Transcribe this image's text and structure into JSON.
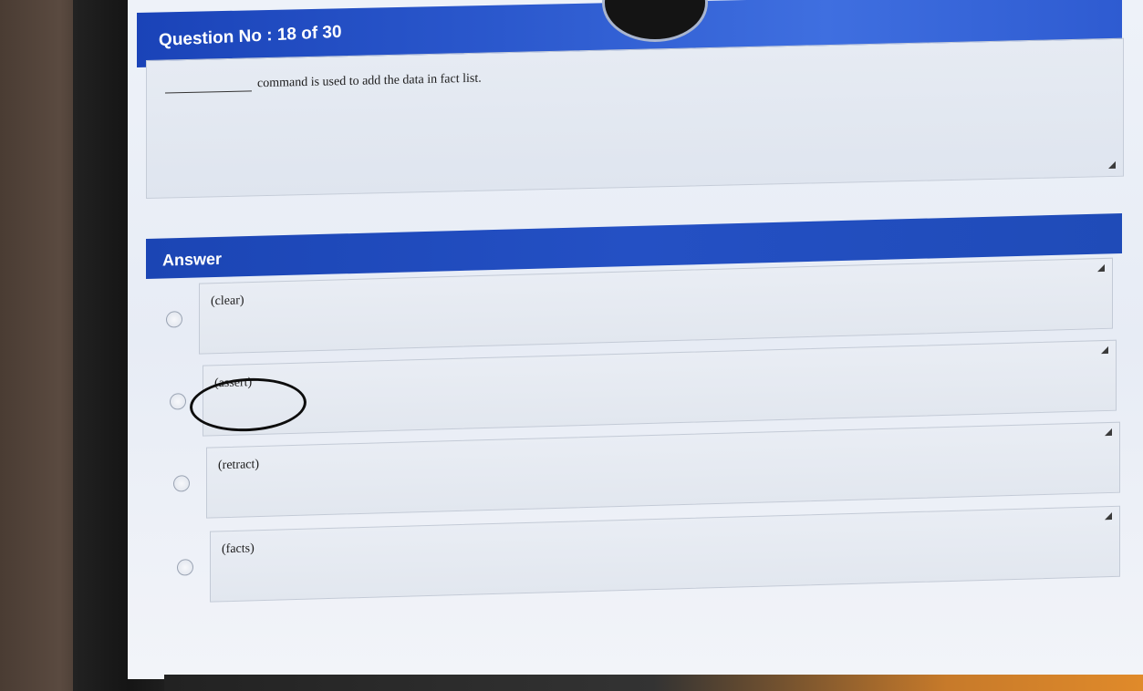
{
  "question": {
    "header": "Question No : 18 of 30",
    "text": "command is used to add the data in fact list."
  },
  "answer": {
    "header": "Answer",
    "options": [
      {
        "label": "(clear)",
        "selected": false,
        "circled": false
      },
      {
        "label": "(assert)",
        "selected": false,
        "circled": true
      },
      {
        "label": "(retract)",
        "selected": false,
        "circled": false
      },
      {
        "label": "(facts)",
        "selected": false,
        "circled": false
      }
    ]
  },
  "colors": {
    "header_blue": "#2a57cc",
    "answer_blue": "#1f4bb8",
    "screen_background": "#eef2f9",
    "hand_drawn_circle": "#0d0d0d"
  }
}
